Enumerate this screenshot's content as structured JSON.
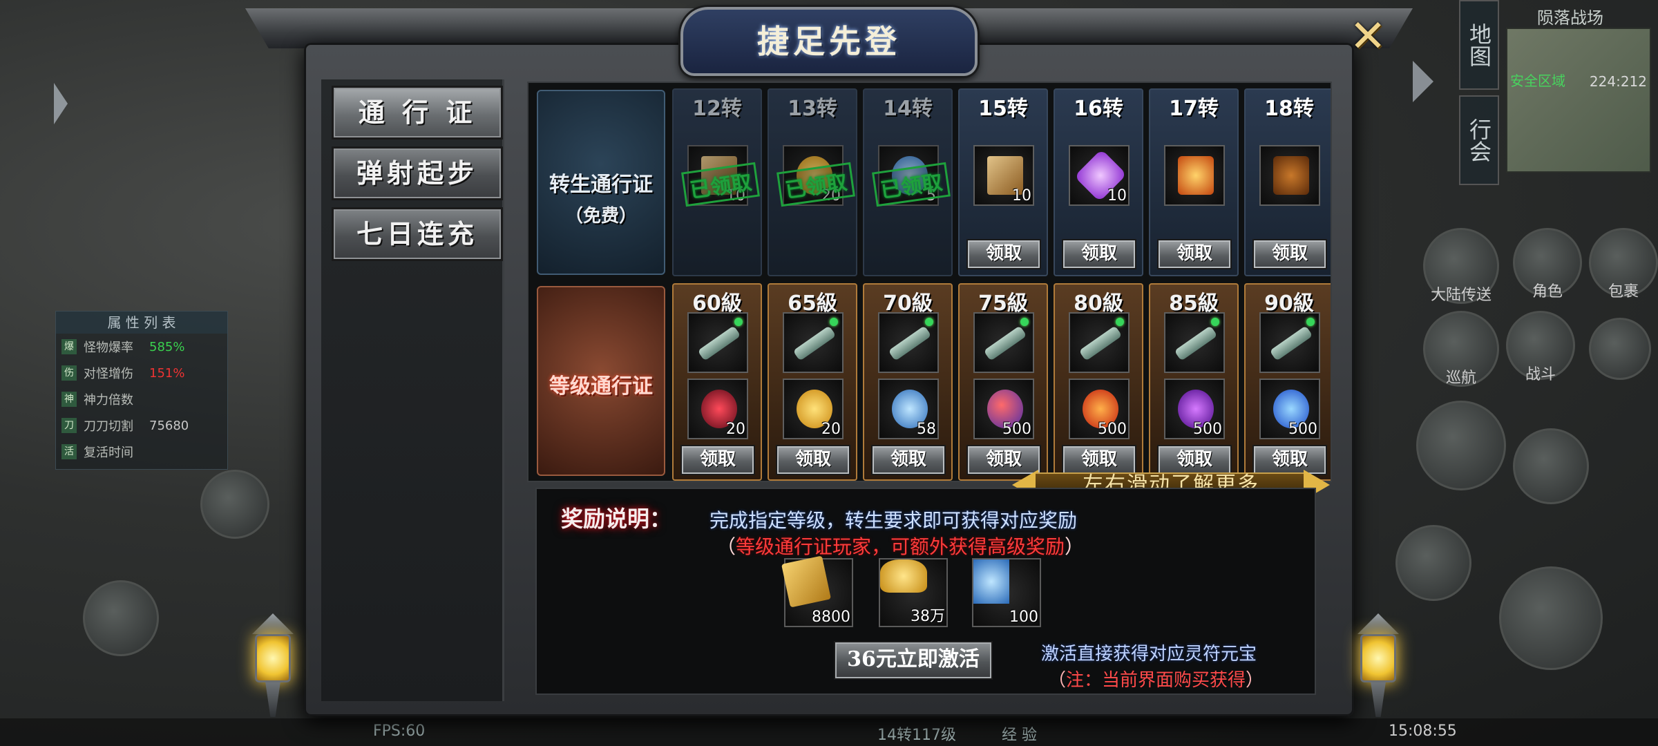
{
  "dialog": {
    "title": "捷足先登",
    "close_glyph": "✕"
  },
  "tabs": [
    "通 行 证",
    "弹射起步",
    "七日连充"
  ],
  "rebirth_pass": {
    "name": "转生通行证",
    "sub": "（免费）"
  },
  "level_pass": {
    "name": "等级通行证"
  },
  "rebirth_columns": [
    {
      "header": "12转",
      "qty": "10",
      "claimed": true,
      "claimed_text": "已领取",
      "icon": "scroll-icon"
    },
    {
      "header": "13转",
      "qty": "20",
      "claimed": true,
      "claimed_text": "已领取",
      "icon": "gold-coin-icon"
    },
    {
      "header": "14转",
      "qty": "5",
      "claimed": true,
      "claimed_text": "已领取",
      "icon": "blue-spirit-icon"
    },
    {
      "header": "15转",
      "qty": "10",
      "claimed": false,
      "button": "领取",
      "icon": "scroll-icon"
    },
    {
      "header": "16转",
      "qty": "10",
      "claimed": false,
      "button": "领取",
      "icon": "purple-crystal-icon"
    },
    {
      "header": "17转",
      "qty": "",
      "claimed": false,
      "button": "领取",
      "icon": "fire-scroll-icon"
    },
    {
      "header": "18转",
      "qty": "",
      "claimed": false,
      "button": "领取",
      "icon": "dragon-tablet-icon"
    }
  ],
  "level_columns": [
    {
      "header": "60級",
      "qty": "20",
      "button": "领取",
      "icon": "red-demon-icon"
    },
    {
      "header": "65級",
      "qty": "20",
      "button": "领取",
      "icon": "gold-coin-icon"
    },
    {
      "header": "70級",
      "qty": "58",
      "button": "领取",
      "icon": "blue-spirit-icon"
    },
    {
      "header": "75級",
      "qty": "500",
      "button": "领取",
      "icon": "red-orb-icon"
    },
    {
      "header": "80級",
      "qty": "500",
      "button": "领取",
      "icon": "fire-orb-icon"
    },
    {
      "header": "85級",
      "qty": "500",
      "button": "领取",
      "icon": "purple-orb-icon"
    },
    {
      "header": "90級",
      "qty": "500",
      "button": "领取",
      "icon": "blue-flame-icon"
    }
  ],
  "swipe_hint": "左右滑动了解更多",
  "description": {
    "label": "奖励说明：",
    "line1": "完成指定等级，转生要求即可获得对应奖励",
    "line2_open": "（",
    "line2_red": "等级通行证玩家，可额外获得高级奖励",
    "line2_close": "）"
  },
  "bonus_items": [
    {
      "qty": "8800",
      "icon": "talisman-cards-icon"
    },
    {
      "qty": "38万",
      "icon": "gold-ingot-icon"
    },
    {
      "qty": "100",
      "icon": "blue-spirit-icon"
    }
  ],
  "activate_button": "36元立即激活",
  "note": {
    "line1": "激活直接获得对应灵符元宝",
    "line2_open": "（",
    "line2_red": "注：当前界面购买获得",
    "line2_close": "）"
  },
  "background": {
    "minimap_title": "陨落战场",
    "safe_zone": "安全区域",
    "coords": "224:212",
    "vtab_map": "地图",
    "vtab_guild": "行会",
    "attr_title": "属 性 列 表",
    "attrs": [
      {
        "icon": "爆",
        "label": "怪物爆率",
        "value": "585%"
      },
      {
        "icon": "伤",
        "label": "对怪增伤",
        "value": "151%"
      },
      {
        "icon": "神",
        "label": "神力倍数",
        "value": ""
      },
      {
        "icon": "刀",
        "label": "刀刀切割",
        "value": "75680"
      },
      {
        "icon": "活",
        "label": "复活时间",
        "value": ""
      }
    ],
    "buttons": [
      "大陆传送",
      "角色",
      "包裹",
      "巡航",
      "战斗"
    ],
    "status": {
      "fps": "FPS:60",
      "level": "14转117级",
      "exp_label": "经 验",
      "time": "15:08:55"
    }
  }
}
